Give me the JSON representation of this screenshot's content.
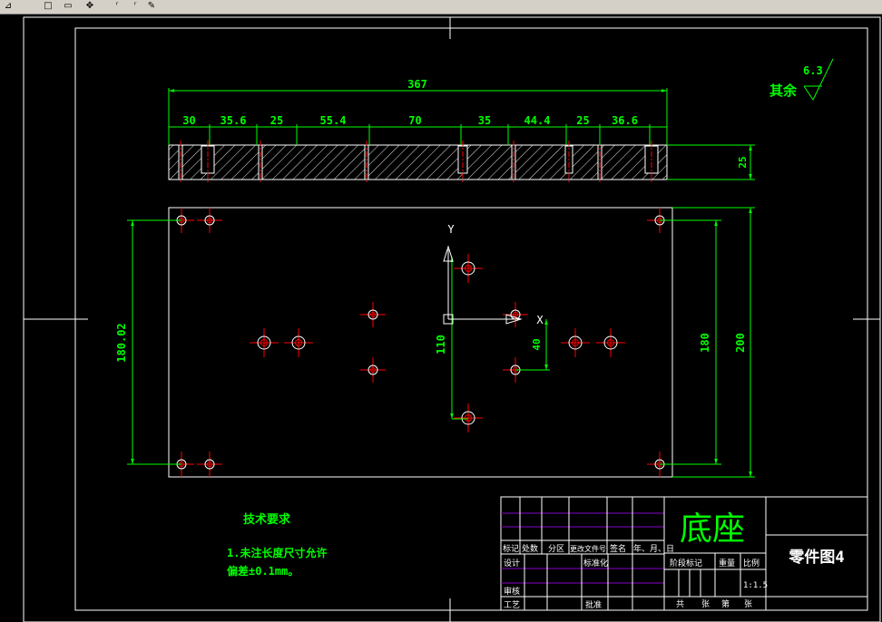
{
  "toolbar": {
    "buttons": [
      {
        "name": "dimension-tool-icon",
        "glyph": "⊿"
      },
      {
        "name": "rectangle-tool-icon",
        "glyph": "□"
      },
      {
        "name": "window-tool-icon",
        "glyph": "▭"
      },
      {
        "name": "snap-tool-icon",
        "glyph": "✥"
      },
      {
        "name": "text-tool-icon",
        "glyph": "ʳ"
      },
      {
        "name": "text-italic-icon",
        "glyph": "ʳ"
      },
      {
        "name": "paint-tool-icon",
        "glyph": "✎"
      }
    ]
  },
  "drawing": {
    "colors": {
      "dim": "#00ff00",
      "outline": "#ffffff",
      "center": "#ff0000",
      "title_text": "#00ff00",
      "hatch": "#ffffff"
    },
    "top_view": {
      "overall": "367",
      "segments": [
        "30",
        "35.6",
        "25",
        "55.4",
        "70",
        "35",
        "44.4",
        "25",
        "36.6"
      ],
      "thickness": "25"
    },
    "plan_view": {
      "left_height": "180.02",
      "inner_height": "180",
      "outer_height": "200",
      "offset_y": "110",
      "offset_x": "40",
      "axis_y": "Y",
      "axis_x": "X"
    },
    "roughness": {
      "label": "其余",
      "value": "6.3"
    },
    "tech_requirements": {
      "title": "技术要求",
      "line1": "1.未注长度尺寸允许",
      "line2": "偏差±0.1mm。"
    },
    "title_block": {
      "part_title": "底座",
      "drawing_no": "零件图4",
      "h_mark": "标记",
      "h_count": "处数",
      "h_zone": "分区",
      "h_change_doc": "更改文件号",
      "h_sign": "签名",
      "h_date": "年、月、日",
      "design": "设计",
      "standardize": "标准化",
      "review": "审核",
      "process": "工艺",
      "approve": "批准",
      "stage_mark": "阶段标记",
      "weight": "重量",
      "scale_label": "比例",
      "scale": "1:1.5",
      "total": "共",
      "sheets": "张",
      "sheet_no": "第"
    }
  }
}
